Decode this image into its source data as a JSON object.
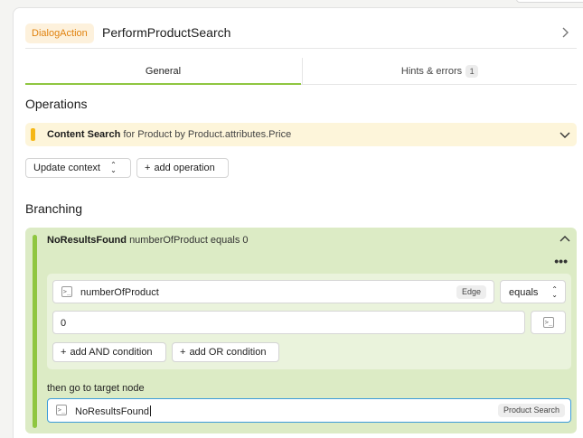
{
  "header": {
    "badge": "DialogAction",
    "title": "PerformProductSearch"
  },
  "tabs": [
    {
      "label": "General"
    },
    {
      "label": "Hints & errors",
      "count": "1"
    }
  ],
  "operations": {
    "title": "Operations",
    "item": {
      "name": "Content Search",
      "detail": "for Product by Product.attributes.Price"
    },
    "select_label": "Update context",
    "add_label": "add operation"
  },
  "branching": {
    "title": "Branching",
    "branch": {
      "name": "NoResultsFound",
      "summary": "numberOfProduct equals 0",
      "more": "•••",
      "condition": {
        "variable": "numberOfProduct",
        "variable_tag": "Edge",
        "operator": "equals",
        "value": "0",
        "add_and_label": "add AND condition",
        "add_or_label": "add OR condition"
      },
      "target_label": "then go to target node",
      "target_value": "NoResultsFound",
      "target_tag": "Product Search"
    }
  },
  "colors": {
    "accent_green": "#8fc640",
    "badge_orange": "#e0820f",
    "focus_blue": "#3a9bd9"
  },
  "icons": {
    "terminal": ">_",
    "plus": "+"
  }
}
